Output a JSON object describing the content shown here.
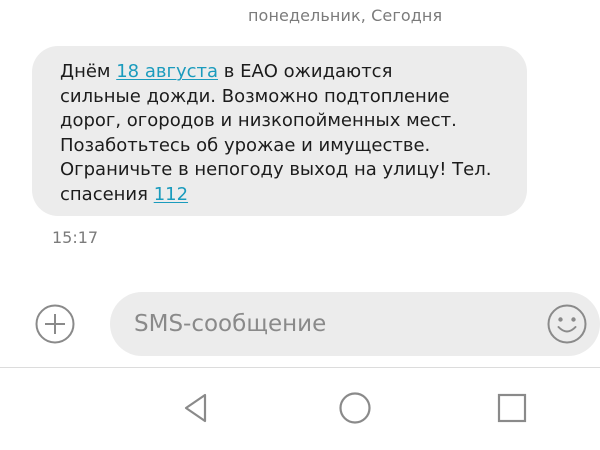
{
  "conversation": {
    "date_header": "понедельник, Сегодня",
    "message": {
      "lines": [
        [
          {
            "text": "Днём ",
            "link": false
          },
          {
            "text": "18 августа",
            "link": true
          },
          {
            "text": " в ЕАО ожидаются",
            "link": false
          }
        ],
        [
          {
            "text": "сильные дожди. Возможно подтопление",
            "link": false
          }
        ],
        [
          {
            "text": "дорог, огородов и низкопойменных мест.",
            "link": false
          }
        ],
        [
          {
            "text": "Позаботьтесь об урожае и имуществе.",
            "link": false
          }
        ],
        [
          {
            "text": "Ограничьте в непогоду выход на улицу! Тел.",
            "link": false
          }
        ],
        [
          {
            "text": "спасения ",
            "link": false
          },
          {
            "text": "112",
            "link": true
          }
        ]
      ],
      "timestamp": "15:17"
    }
  },
  "composer": {
    "placeholder": "SMS-сообщение",
    "value": "",
    "attach_icon": "add-circle-icon",
    "emoji_icon": "smiley-face-icon"
  },
  "navigation": {
    "back_icon": "triangle-back-icon",
    "home_icon": "circle-home-icon",
    "recents_icon": "square-recents-icon"
  },
  "colors": {
    "bubble_bg": "#ececec",
    "link": "#1a9bbd",
    "secondary_text": "#7b7b7b",
    "icon_gray": "#8a8a8a"
  }
}
